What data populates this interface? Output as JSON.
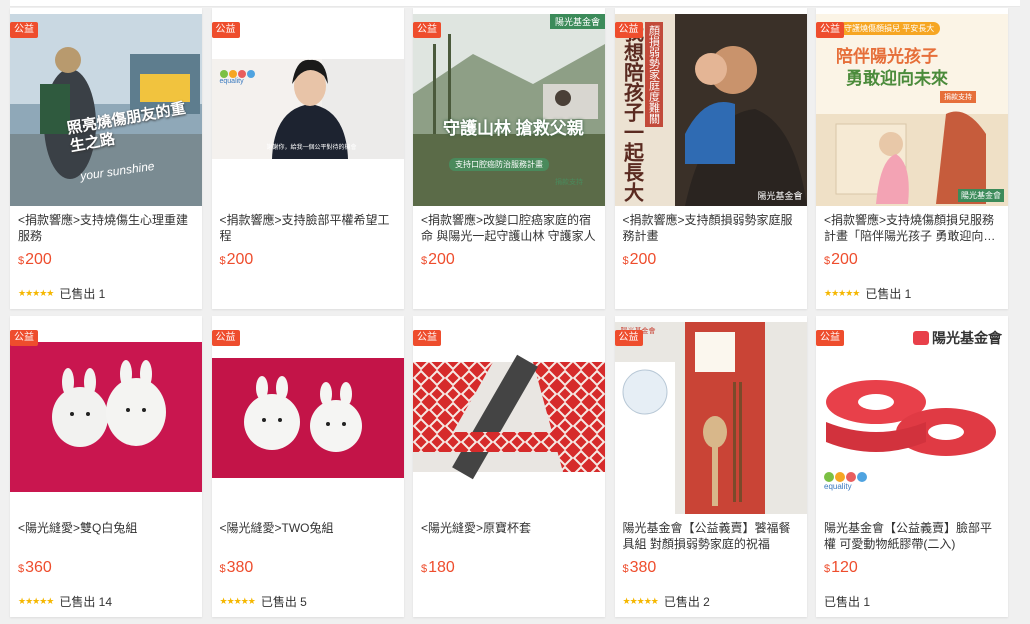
{
  "accent": "#ee4d2d",
  "star_color": "#f5b700",
  "products": [
    {
      "badge": "公益",
      "title": "<捐款響應>支持燒傷生心理重建服務",
      "currency": "$",
      "price": "200",
      "rating": 5,
      "sold": "已售出 1",
      "image": "wildfire-recovery-poster",
      "img_text": "照亮燒傷朋友的重生之路",
      "img_text2": "your sunshine"
    },
    {
      "badge": "公益",
      "title": "<捐款響應>支持臉部平權希望工程",
      "currency": "$",
      "price": "200",
      "rating": null,
      "sold": "",
      "image": "woman-portrait-equality",
      "img_text": "equality",
      "img_caption": "謝謝你，給我一個公平對待的機會"
    },
    {
      "badge": "公益",
      "title": "<捐款響應>改變口腔癌家庭的宿命 與陽光一起守護山林 守護家人",
      "currency": "$",
      "price": "200",
      "rating": null,
      "sold": "",
      "image": "forest-poster",
      "img_text": "守護山林 搶救父親",
      "img_tag": "陽光基金會",
      "img_sub": "支持口腔癌防治服務計畫",
      "img_sub2": "捐款支持"
    },
    {
      "badge": "公益",
      "title": "<捐款響應>支持顏損弱勢家庭服務計畫",
      "currency": "$",
      "price": "200",
      "rating": null,
      "sold": "",
      "image": "family-hug-poster",
      "img_text": "我想陪孩子一起長大",
      "img_side": "顏損弱勢家庭度難關",
      "img_tag": "陽光基金會"
    },
    {
      "badge": "公益",
      "title": "<捐款響應>支持燒傷顏損兒服務計畫「陪伴陽光孩子 勇敢迎向未來」",
      "currency": "$",
      "price": "200",
      "rating": 5,
      "sold": "已售出 1",
      "image": "child-poster",
      "img_top": "守護燒傷顏損兒 平安長大",
      "img_text": "陪伴陽光孩子",
      "img_text2": "勇敢迎向未來",
      "img_sub": "捐款支持",
      "img_tag": "陽光基金會"
    },
    {
      "badge": "公益",
      "title": "<陽光縫愛>雙Q白兔組",
      "currency": "$",
      "price": "360",
      "rating": 5,
      "sold": "已售出 14",
      "image": "two-white-bunnies"
    },
    {
      "badge": "公益",
      "title": "<陽光縫愛>TWO兔組",
      "currency": "$",
      "price": "380",
      "rating": 5,
      "sold": "已售出 5",
      "image": "two-white-bunnies-pink"
    },
    {
      "badge": "公益",
      "title": "<陽光縫愛>原寶杯套",
      "currency": "$",
      "price": "180",
      "rating": null,
      "sold": "",
      "image": "red-pattern-cup-sleeve"
    },
    {
      "badge": "公益",
      "title": "陽光基金會【公益義賣】饕福餐具組 對顏損弱勢家庭的祝福",
      "currency": "$",
      "price": "380",
      "rating": 5,
      "sold": "已售出 2",
      "image": "cutlery-set",
      "img_logo": "陽光基金會"
    },
    {
      "badge": "公益",
      "title": "陽光基金會【公益義賣】臉部平權 可愛動物紙膠帶(二入)",
      "currency": "$",
      "price": "120",
      "rating": null,
      "sold": "已售出 1",
      "image": "washi-tape",
      "img_logo": "陽光基金會",
      "img_text": "equality"
    }
  ]
}
